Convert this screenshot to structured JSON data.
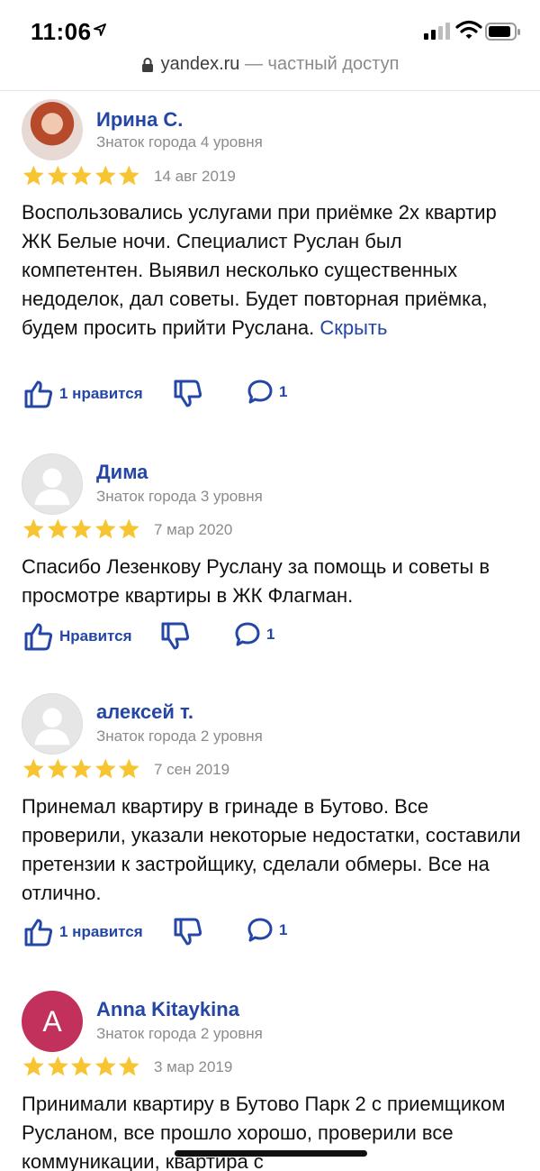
{
  "status": {
    "time": "11:06"
  },
  "url": {
    "host": "yandex.ru",
    "suffix": " — частный доступ"
  },
  "reviews": [
    {
      "name": "Ирина С.",
      "level": "Знаток города 4 уровня",
      "date": "14 авг 2019",
      "stars": 5,
      "text": "Воспользовались услугами при приёмке 2х квартир ЖК Белые ночи. Специалист Руслан был компетентен. Выявил несколько существенных недоделок, дал советы. Будет повторная приёмка, будем просить прийти Руслана.",
      "more": "Скрыть",
      "like_label": "1 нравится",
      "comments": "1"
    },
    {
      "name": "Дима",
      "level": "Знаток города 3 уровня",
      "date": "7 мар 2020",
      "stars": 5,
      "text": "Спасибо Лезенкову Руслану за помощь и советы в просмотре квартиры в ЖК Флагман.",
      "like_label": "Нравится",
      "comments": "1"
    },
    {
      "name": "алексей т.",
      "level": "Знаток города 2 уровня",
      "date": "7 сен 2019",
      "stars": 5,
      "text": "Принемал квартиру в гринаде в Бутово. Все проверили, указали некоторые недостатки, составили претензии к застройщику, сделали обмеры. Все на отлично.",
      "like_label": "1 нравится",
      "comments": "1"
    },
    {
      "name": "Anna Kitaykina",
      "avatar_letter": "A",
      "level": "Знаток города 2 уровня",
      "date": "3 мар 2019",
      "stars": 5,
      "text": "Принимали квартиру в Бутово Парк 2 с приемщиком Русланом, все прошло хорошо, проверили все коммуникации, квартира с"
    }
  ],
  "colors": {
    "accent": "#2446a6",
    "star": "#f7c531",
    "avatar_letter_bg": "#c2305c"
  }
}
